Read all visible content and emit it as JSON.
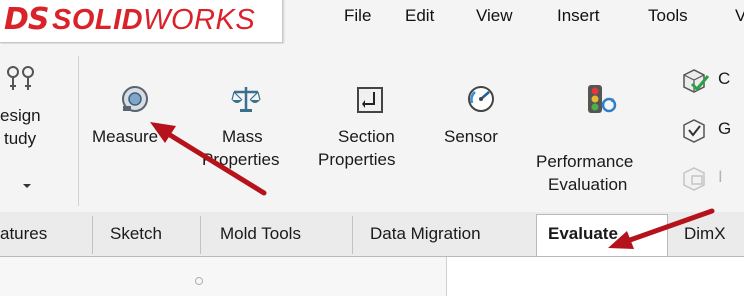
{
  "brand": {
    "logo_mark": "DS",
    "logo_bold": "SOLID",
    "logo_light": "WORKS",
    "color": "#d9222a"
  },
  "menu": [
    "File",
    "Edit",
    "View",
    "Insert",
    "Tools",
    "V"
  ],
  "ribbon": {
    "design_study": {
      "line1": "esign",
      "line2": "tudy",
      "dropdown_icon": "chevron-down-icon"
    },
    "commands": [
      {
        "id": "measure",
        "label": "Measure",
        "icon": "measure-icon"
      },
      {
        "id": "mass-properties",
        "line1": "Mass",
        "line2": "Properties",
        "icon": "scales-icon"
      },
      {
        "id": "section-properties",
        "line1": "Section",
        "line2": "Properties",
        "icon": "section-icon"
      },
      {
        "id": "sensor",
        "label": "Sensor",
        "icon": "gauge-icon"
      },
      {
        "id": "performance-evaluation",
        "line1": "Performance",
        "line2": "Evaluation",
        "icon": "traffic-light-icon"
      }
    ],
    "small_commands": [
      {
        "label": "C",
        "icon": "check-cube-icon",
        "enabled": true
      },
      {
        "label": "G",
        "icon": "geometry-check-icon",
        "enabled": true
      },
      {
        "label": "I",
        "icon": "import-diagnostics-icon",
        "enabled": false
      }
    ]
  },
  "tabs": [
    {
      "label": "atures"
    },
    {
      "label": "Sketch"
    },
    {
      "label": "Mold Tools"
    },
    {
      "label": "Data Migration"
    },
    {
      "label": "Evaluate",
      "active": true
    },
    {
      "label": "DimX"
    }
  ],
  "colors": {
    "arrow": "#b5121b",
    "ribbon_bg": "#f4f4f4",
    "tab_bg": "#ebebeb"
  }
}
